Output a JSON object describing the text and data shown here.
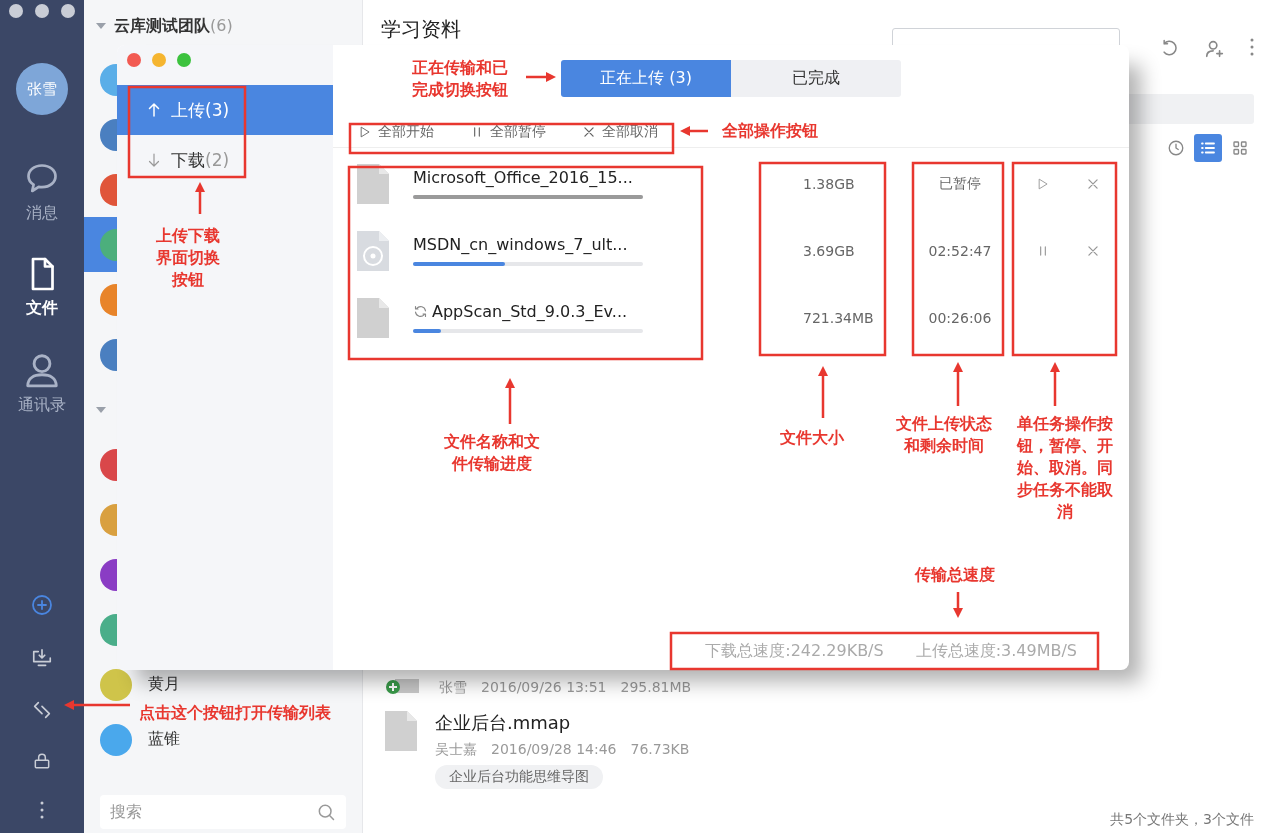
{
  "rail": {
    "avatar": "张雪",
    "items": [
      {
        "label": "消息",
        "kind": "chat",
        "selected": false
      },
      {
        "label": "文件",
        "kind": "file",
        "selected": true
      },
      {
        "label": "通讯录",
        "kind": "contacts",
        "selected": false
      }
    ]
  },
  "contacts": {
    "group": {
      "name": "云库测试团队",
      "count": "(6)",
      "expanded": true
    },
    "people": [
      {
        "color": "#5aaee8",
        "selected": false
      },
      {
        "color": "#4a7fc0",
        "selected": false
      },
      {
        "color": "#e0553a",
        "selected": false
      },
      {
        "color": "#4caf7c",
        "selected": true
      },
      {
        "color": "#e8842a",
        "selected": false
      },
      {
        "color": "#4a7fc0",
        "selected": false
      }
    ],
    "second_group": [
      {
        "color": "#d9474a",
        "selected": false
      },
      {
        "color": "#d9a040",
        "selected": false
      },
      {
        "color": "#8a3cc4",
        "selected": false
      },
      {
        "color": "#4aae8a",
        "selected": false
      },
      {
        "name": "黄月",
        "color": "#cfc44a",
        "selected": false
      },
      {
        "name": "蓝锥",
        "color": "#4aa8ec",
        "selected": false
      }
    ],
    "search": {
      "placeholder": "搜索"
    }
  },
  "main": {
    "title": "学习资料",
    "views": [
      {
        "kind": "recent",
        "selected": false
      },
      {
        "kind": "list",
        "selected": true
      },
      {
        "kind": "grid",
        "selected": false
      }
    ],
    "files": [
      {
        "kind": "upload",
        "owner": "张雪",
        "date": "2016/09/26 13:51",
        "size": "295.81MB"
      },
      {
        "kind": "document",
        "name": "企业后台.mmap",
        "owner": "吴士嘉",
        "date": "2016/09/28 14:46",
        "size": "76.73KB",
        "tag": "企业后台功能思维导图"
      }
    ],
    "footer": "共5个文件夹，3个文件"
  },
  "transfer_window": {
    "nav": [
      {
        "label": "上传",
        "count": "(3)",
        "kind": "up",
        "selected": true
      },
      {
        "label": "下载",
        "count": "(2)",
        "kind": "down",
        "selected": false
      }
    ],
    "tabs": [
      {
        "label": "正在上传 (3)",
        "selected": true
      },
      {
        "label": "已完成",
        "selected": false
      }
    ],
    "actions": [
      {
        "kind": "start",
        "label": "全部开始"
      },
      {
        "kind": "pause",
        "label": "全部暂停"
      },
      {
        "kind": "cancel",
        "label": "全部取消"
      }
    ],
    "rows": [
      {
        "kind": "document",
        "name": "Microsoft_Office_2016_15...",
        "syncing": false,
        "paused": true,
        "level": 1,
        "size": "1.38GB",
        "status": "已暂停",
        "controls": [
          {
            "kind": "start"
          },
          {
            "kind": "cancel"
          }
        ]
      },
      {
        "kind": "disc",
        "name": "MSDN_cn_windows_7_ult...",
        "syncing": false,
        "paused": false,
        "level": 0.4,
        "size": "3.69GB",
        "status": "02:52:47",
        "controls": [
          {
            "kind": "pause"
          },
          {
            "kind": "cancel"
          }
        ]
      },
      {
        "kind": "document",
        "name": "AppScan_Std_9.0.3_Ev...",
        "syncing": true,
        "paused": false,
        "level": 0.12,
        "size": "721.34MB",
        "status": "00:26:06"
      }
    ],
    "speeds": [
      "下载总速度:242.29KB/S",
      "上传总速度:3.49MB/S"
    ]
  },
  "annotations": [
    {
      "text": "上传下载界面切换按钮"
    },
    {
      "text": "正在传输和已完成切换按钮"
    },
    {
      "text": "全部操作按钮"
    },
    {
      "text": "文件名称和文件传输进度"
    },
    {
      "text": "文件大小"
    },
    {
      "text": "文件上传状态和剩余时间"
    },
    {
      "text": "单任务操作按钮，暂停、开始、取消。同步任务不能取消"
    },
    {
      "text": "传输总速度"
    },
    {
      "text": "点击这个按钮打开传输列表"
    }
  ]
}
